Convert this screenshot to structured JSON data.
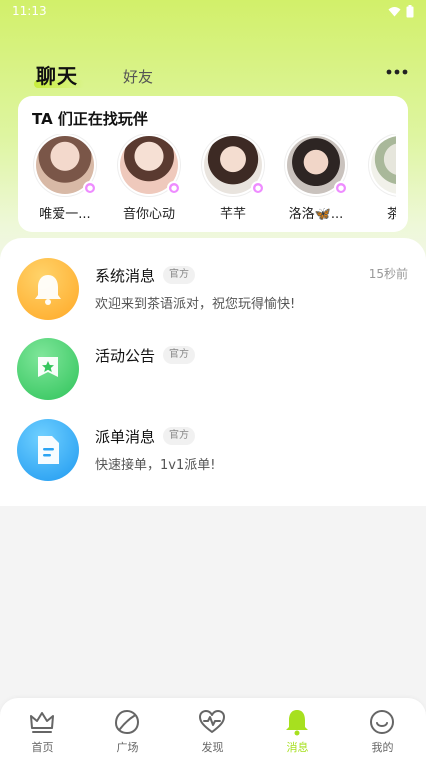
{
  "status_bar": {
    "time": "11:13"
  },
  "header": {
    "tab_chat": "聊天",
    "tab_friends": "好友"
  },
  "finder": {
    "title": "TA 们正在找玩伴",
    "people": [
      {
        "name": "唯爱一..."
      },
      {
        "name": "音你心动"
      },
      {
        "name": "芊芊"
      },
      {
        "name": "洛洛🦋..."
      },
      {
        "name": "茶语"
      }
    ]
  },
  "messages": [
    {
      "title": "系统消息",
      "badge": "官方",
      "preview": "欢迎来到茶语派对，祝您玩得愉快!",
      "time": "15秒前"
    },
    {
      "title": "活动公告",
      "badge": "官方",
      "preview": "",
      "time": ""
    },
    {
      "title": "派单消息",
      "badge": "官方",
      "preview": "快速接单，1v1派单!",
      "time": ""
    }
  ],
  "bottom_nav": {
    "items": [
      {
        "label": "首页",
        "icon": "crown-icon"
      },
      {
        "label": "广场",
        "icon": "leaf-icon"
      },
      {
        "label": "发现",
        "icon": "heart-pulse-icon"
      },
      {
        "label": "消息",
        "icon": "bell-icon",
        "active": true
      },
      {
        "label": "我的",
        "icon": "smile-face-icon"
      }
    ]
  },
  "colors": {
    "accent": "#a7e01f",
    "system_icon": "#ffb52e",
    "activity_icon": "#3fd06a",
    "dispatch_icon": "#2eaaf5"
  }
}
